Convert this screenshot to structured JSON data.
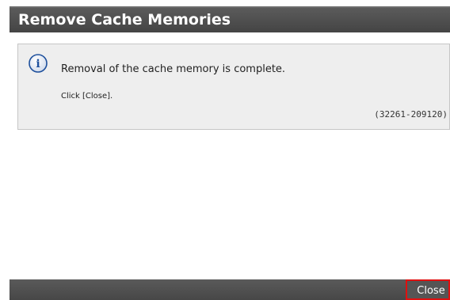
{
  "dialog": {
    "title": "Remove Cache Memories",
    "message": {
      "icon": "info-icon",
      "main_text": "Removal of the cache memory is complete.",
      "sub_text": "Click [Close].",
      "code": "(32261-209120)"
    },
    "footer": {
      "close_label": "Close"
    }
  },
  "colors": {
    "title_bar": "#4a4a4a",
    "message_bg": "#eeeeee",
    "icon_blue": "#1d4f9c",
    "close_highlight": "#e01010"
  }
}
